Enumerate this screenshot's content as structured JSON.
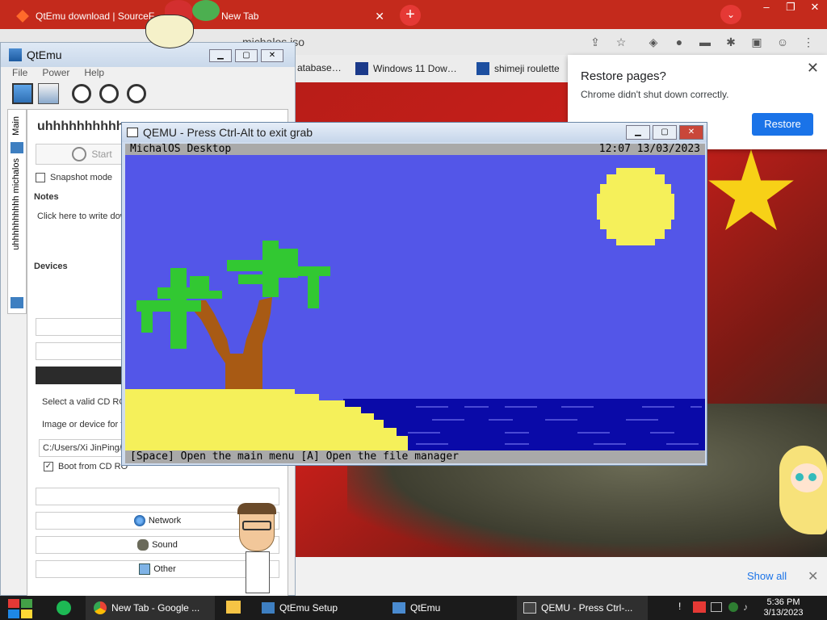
{
  "chrome": {
    "tabs": [
      {
        "label": "QtEmu download | SourceF"
      },
      {
        "label": "New Tab"
      }
    ],
    "url": "michalos.iso",
    "bookmarks": [
      {
        "label": "atabase…"
      },
      {
        "label": "Windows 11 Dow…"
      },
      {
        "label": "shimeji roulette"
      }
    ],
    "restore_popup": {
      "title": "Restore pages?",
      "message": "Chrome didn't shut down correctly.",
      "button": "Restore"
    },
    "download_bar": {
      "show_all": "Show all"
    }
  },
  "qtemu": {
    "title": "QtEmu",
    "menu": [
      "File",
      "Power",
      "Help"
    ],
    "side_tabs": {
      "main": "Main",
      "vm": "uhhhhhhhhhh michalos"
    },
    "vm_name": "uhhhhhhhhhh",
    "start_label": "Start",
    "snapshot_label": "Snapshot mode",
    "notes_heading": "Notes",
    "notes_placeholder": "Click here to write dow",
    "devices_heading": "Devices",
    "cd_rom_label": "Select a valid CD RO",
    "image_label": "Image or device for t",
    "image_path": "C:/Users/Xi JinPing/",
    "boot_cd_label": "Boot from CD RO",
    "device_buttons": [
      "Network",
      "Sound",
      "Other"
    ]
  },
  "qemu": {
    "title": "QEMU - Press Ctrl-Alt to exit grab",
    "os_title": "MichalOS Desktop",
    "clock": "12:07 13/03/2023",
    "bottom_bar": "[Space] Open the main menu [A] Open the file manager",
    "colors": {
      "sky": "#5356e8",
      "sun": "#f5f05a",
      "sand": "#f5f05a",
      "sea": "#0a0aa8",
      "palm_leaf": "#32c832",
      "trunk": "#a85a14",
      "bar": "#a9a9a9"
    }
  },
  "taskbar": {
    "items": [
      {
        "label": "New Tab - Google ..."
      },
      {
        "label": "QtEmu Setup"
      },
      {
        "label": "QtEmu"
      },
      {
        "label": "QEMU - Press Ctrl-..."
      }
    ],
    "time": "5:36 PM",
    "date": "3/13/2023"
  }
}
